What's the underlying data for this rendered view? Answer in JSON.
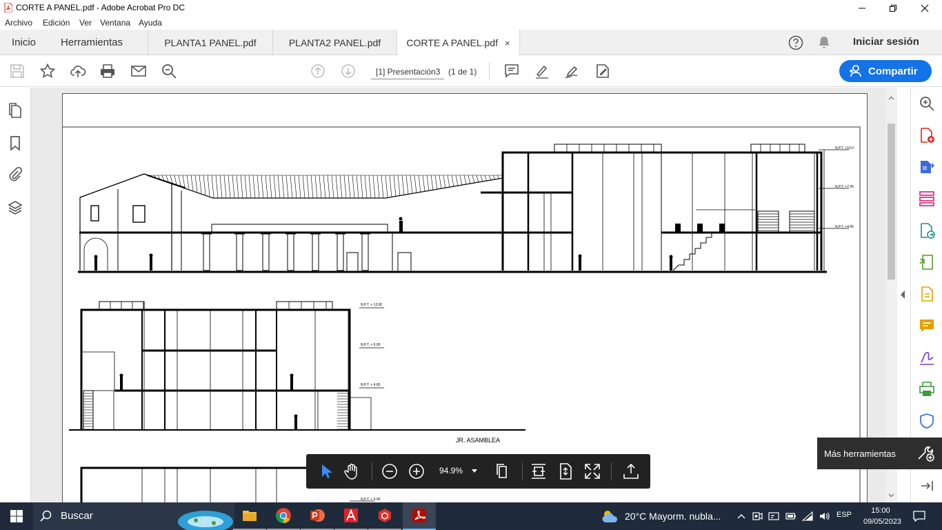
{
  "window": {
    "title": "CORTE A PANEL.pdf - Adobe Acrobat Pro DC"
  },
  "menu": [
    "Archivo",
    "Edición",
    "Ver",
    "Ventana",
    "Ayuda"
  ],
  "nav": {
    "home": "Inicio",
    "tools": "Herramientas"
  },
  "tabs": [
    {
      "label": "PLANTA1 PANEL.pdf",
      "active": false
    },
    {
      "label": "PLANTA2 PANEL.pdf",
      "active": false
    },
    {
      "label": "CORTE A PANEL.pdf",
      "active": true,
      "close": "×"
    }
  ],
  "account": {
    "signin": "Iniciar sesión"
  },
  "toolbar": {
    "page_field": "[1] Presentación3",
    "page_count": "(1 de 1)",
    "share_label": "Compartir"
  },
  "drawing": {
    "street_label": "JR. ASAMBLEA",
    "levels_section1": [
      "N.P.T. +10.0",
      "N.P.T. +7.05",
      "N.P.T. +4.65"
    ],
    "levels_section2": [
      "N.P.T. + 13.50",
      "N.P.T. + 9.00",
      "N.P.T. + 4.65"
    ],
    "levels_section3": [
      "N.P.T. + 9.00"
    ]
  },
  "floatbar": {
    "zoom": "94.9%"
  },
  "tooltip": {
    "label": "Más herramientas"
  },
  "taskbar": {
    "search": "Buscar",
    "weather": "20°C  Mayorm. nubla...",
    "lang": "ESP",
    "time": "15:00",
    "date": "09/05/2023"
  },
  "colors": {
    "accent": "#1473e6",
    "taskbar": "#1f2b3a",
    "acrobat_red": "#e0241b"
  }
}
